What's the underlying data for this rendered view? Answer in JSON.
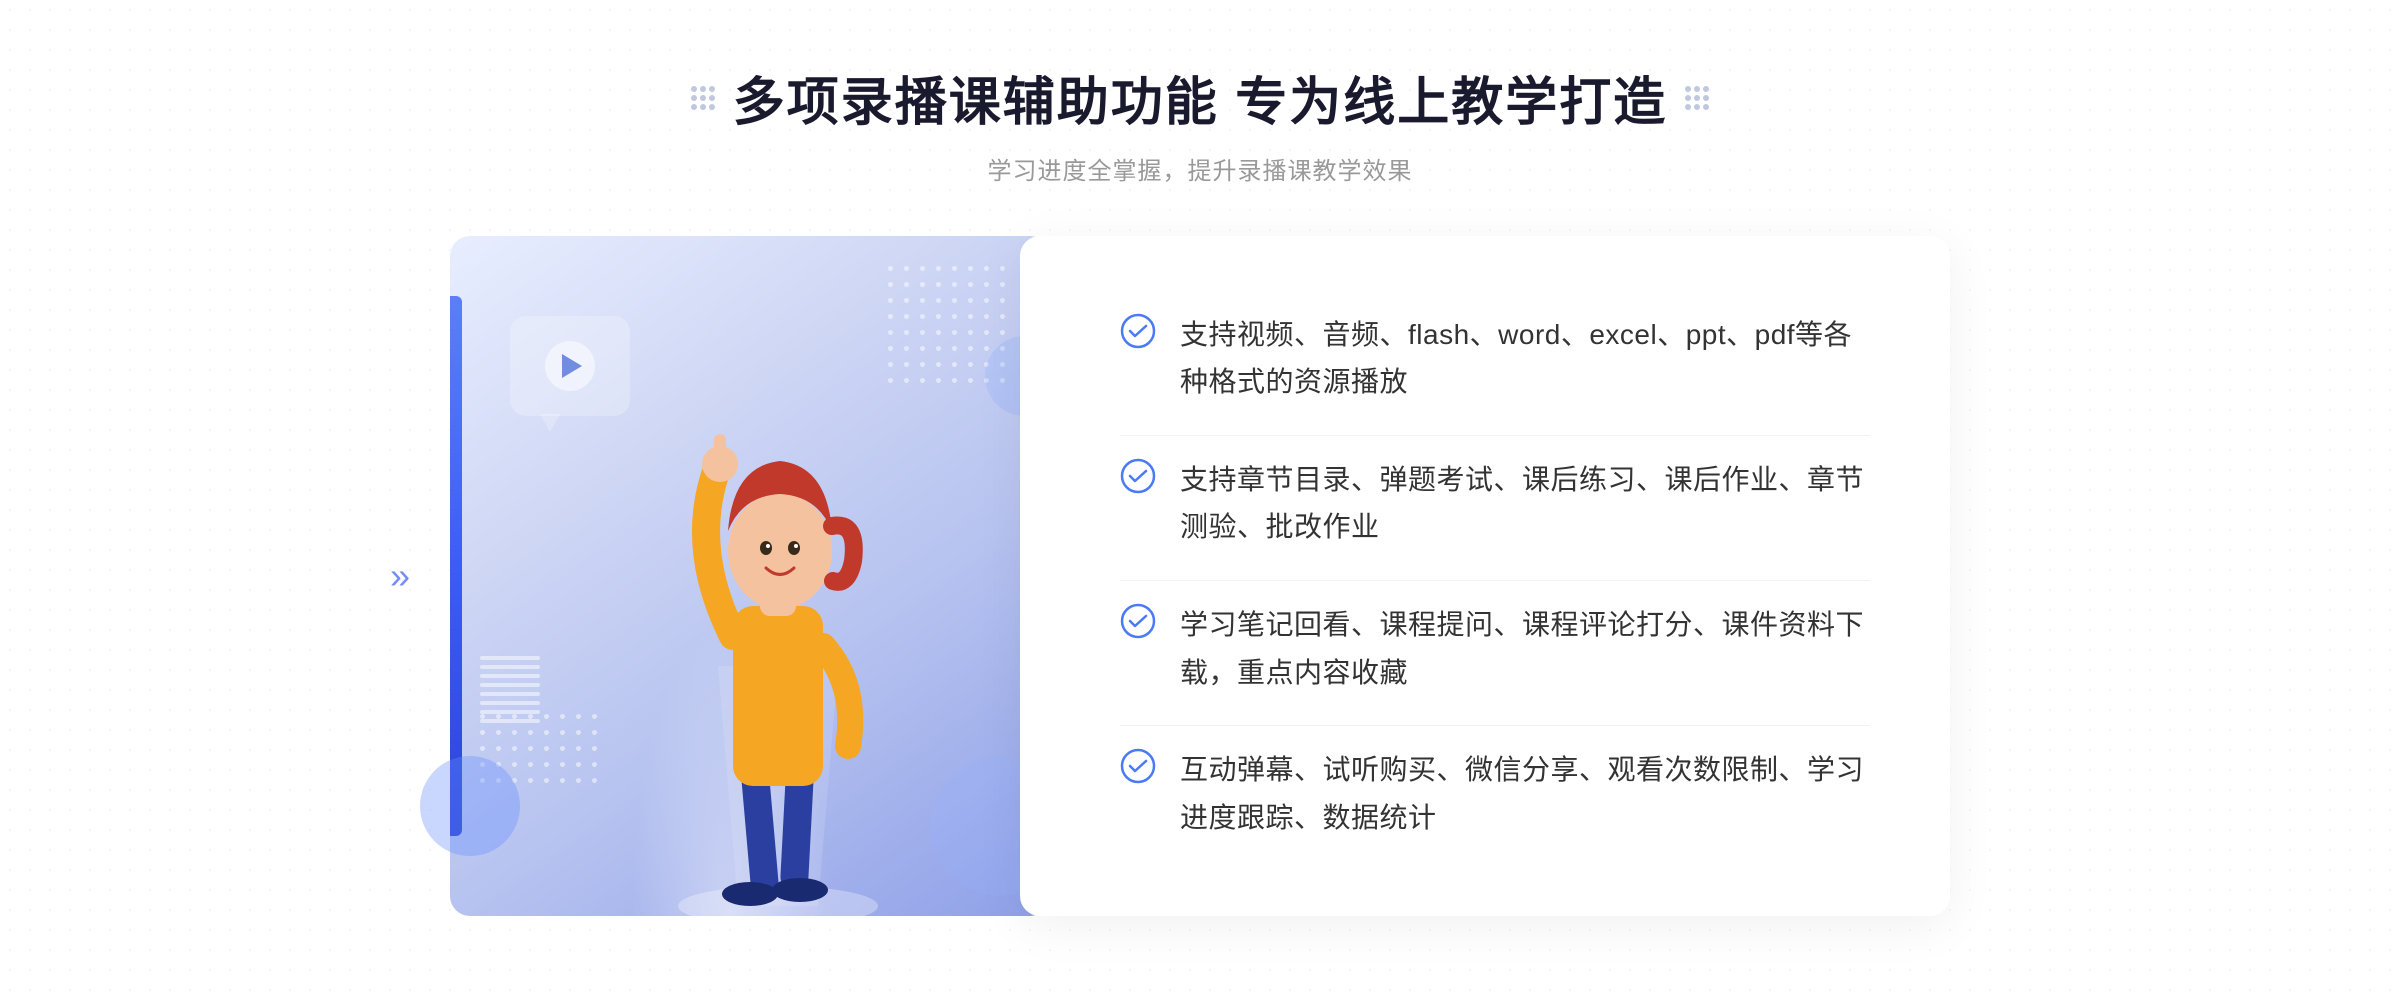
{
  "header": {
    "main_title": "多项录播课辅助功能 专为线上教学打造",
    "sub_title": "学习进度全掌握，提升录播课教学效果"
  },
  "features": [
    {
      "id": 1,
      "text": "支持视频、音频、flash、word、excel、ppt、pdf等各种格式的资源播放"
    },
    {
      "id": 2,
      "text": "支持章节目录、弹题考试、课后练习、课后作业、章节测验、批改作业"
    },
    {
      "id": 3,
      "text": "学习笔记回看、课程提问、课程评论打分、课件资料下载，重点内容收藏"
    },
    {
      "id": 4,
      "text": "互动弹幕、试听购买、微信分享、观看次数限制、学习进度跟踪、数据统计"
    }
  ],
  "icons": {
    "check_color": "#4a7af5",
    "play_color": "#5b7ff8"
  }
}
